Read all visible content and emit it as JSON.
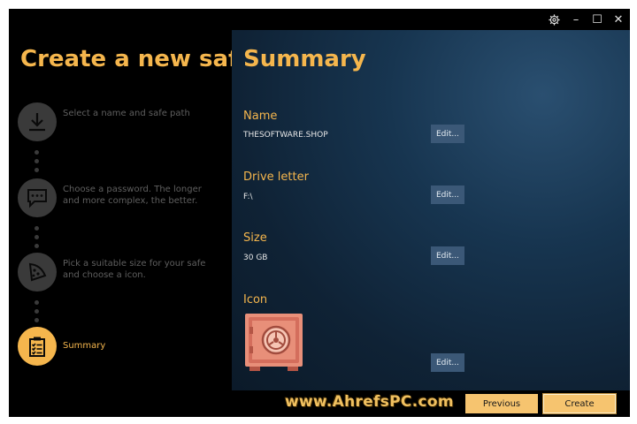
{
  "window": {
    "controls": {
      "settings_icon": "gear-icon",
      "minimize": "–",
      "maximize": "☐",
      "close": "✕"
    }
  },
  "sidebar": {
    "title": "Create a new safe",
    "steps": [
      {
        "icon": "download-icon",
        "text": "Select a name and safe path",
        "active": false
      },
      {
        "icon": "chat-icon",
        "text": "Choose a password. The longer and more complex, the better.",
        "active": false
      },
      {
        "icon": "pizza-icon",
        "text": "Pick a suitable size for your safe and choose a icon.",
        "active": false
      },
      {
        "icon": "clipboard-checklist-icon",
        "text": "Summary",
        "active": true
      }
    ],
    "accent_color": "#f5b64d"
  },
  "summary": {
    "title": "Summary",
    "name": {
      "label": "Name",
      "value": "THESOFTWARE.SHOP",
      "edit": "Edit..."
    },
    "drive": {
      "label": "Drive letter",
      "value": "F:\\",
      "edit": "Edit..."
    },
    "size": {
      "label": "Size",
      "value": "30 GB",
      "edit": "Edit..."
    },
    "icon": {
      "label": "Icon",
      "icon": "safe-icon",
      "edit": "Edit..."
    }
  },
  "footer": {
    "watermark": "www.AhrefsPC.com",
    "previous_label": "Previous",
    "create_label": "Create"
  }
}
